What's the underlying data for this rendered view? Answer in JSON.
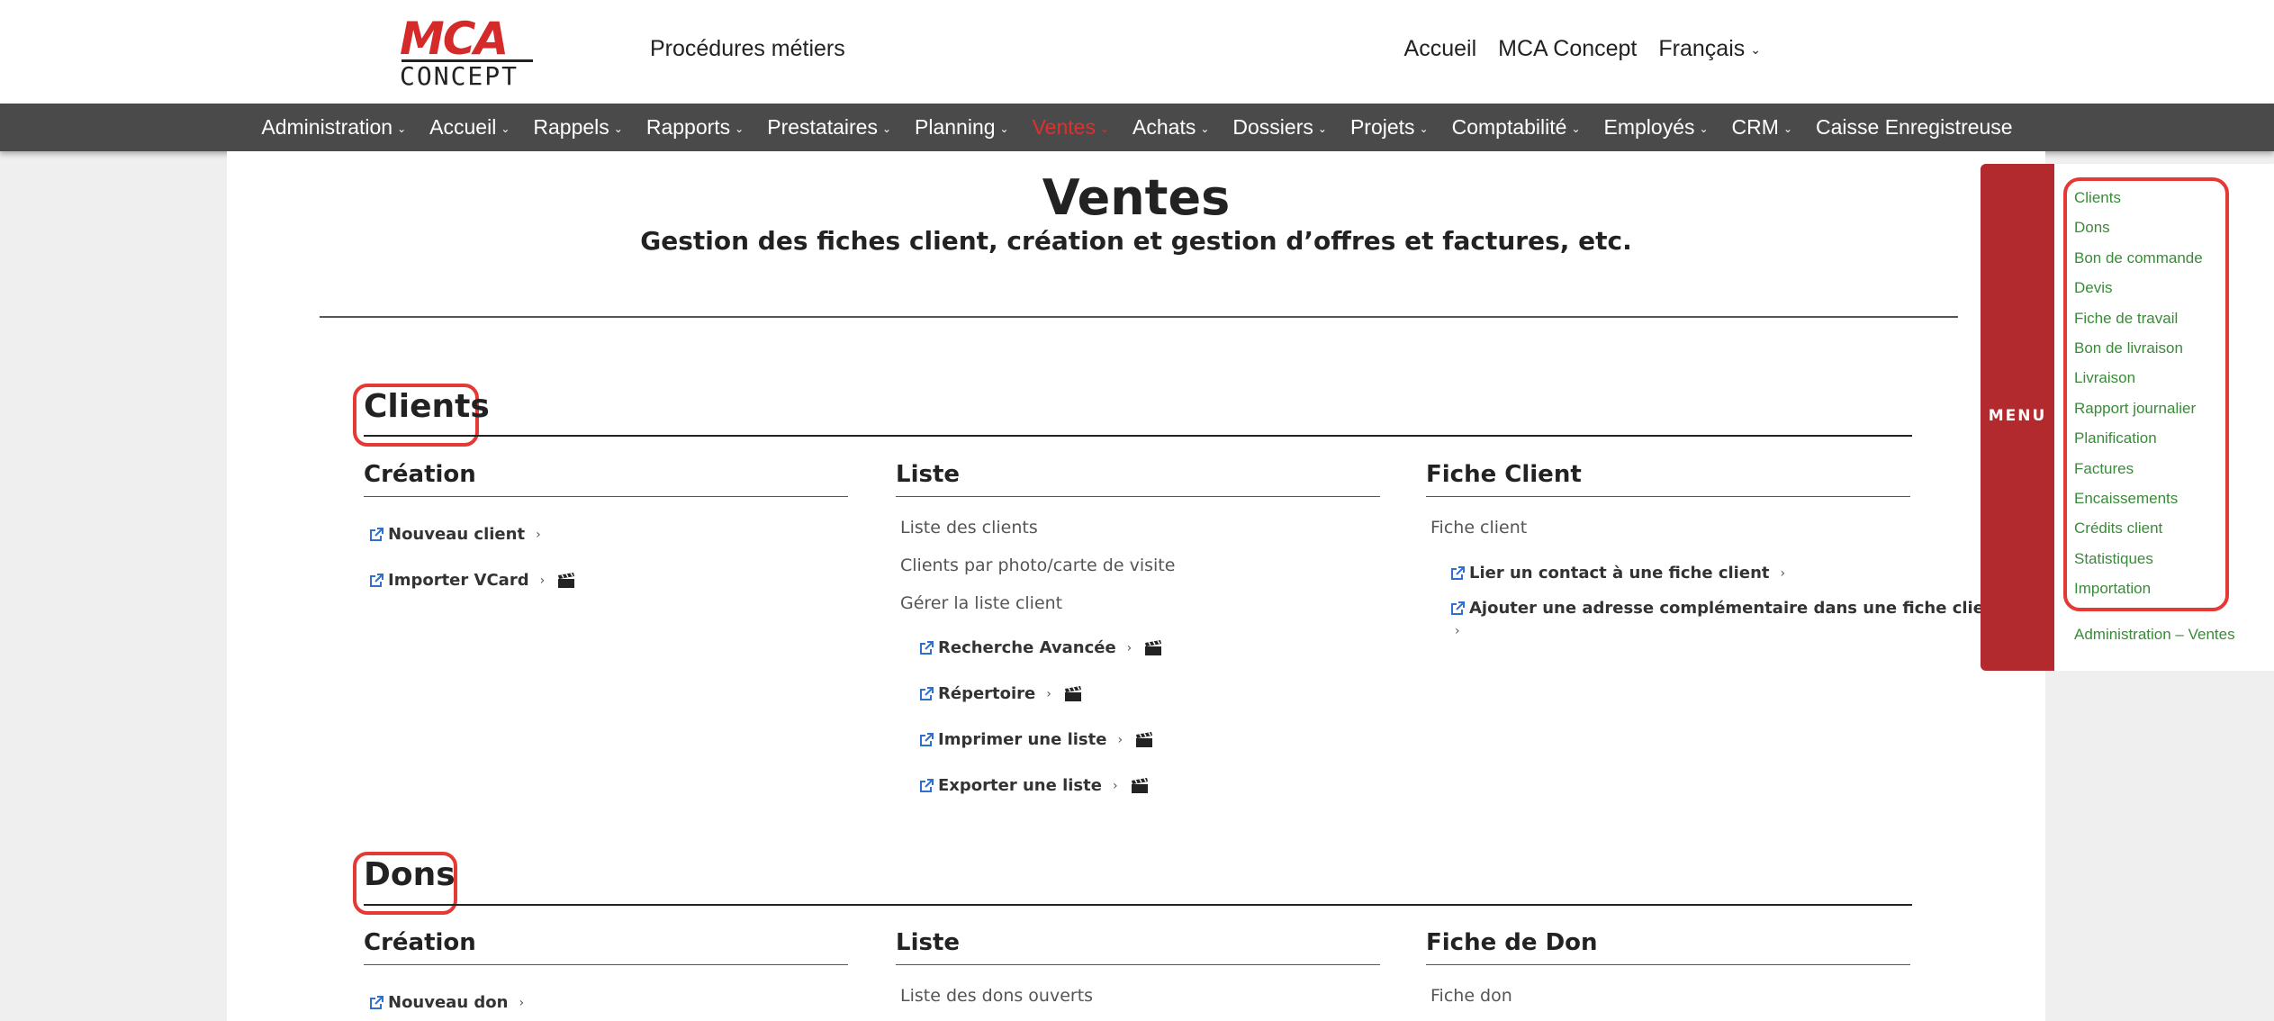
{
  "header": {
    "logo_top": "MCA",
    "logo_bottom": "CONCEPT",
    "title": "Procédures métiers",
    "links": [
      "Accueil",
      "MCA Concept",
      "Français"
    ]
  },
  "nav": [
    {
      "label": "Administration",
      "chevron": true
    },
    {
      "label": "Accueil",
      "chevron": true
    },
    {
      "label": "Rappels",
      "chevron": true
    },
    {
      "label": "Rapports",
      "chevron": true
    },
    {
      "label": "Prestataires",
      "chevron": true
    },
    {
      "label": "Planning",
      "chevron": true
    },
    {
      "label": "Ventes",
      "chevron": true,
      "active": true
    },
    {
      "label": "Achats",
      "chevron": true
    },
    {
      "label": "Dossiers",
      "chevron": true
    },
    {
      "label": "Projets",
      "chevron": true
    },
    {
      "label": "Comptabilité",
      "chevron": true
    },
    {
      "label": "Employés",
      "chevron": true
    },
    {
      "label": "CRM",
      "chevron": true
    },
    {
      "label": "Caisse Enregistreuse",
      "chevron": false
    }
  ],
  "page": {
    "title": "Ventes",
    "subtitle": "Gestion des fiches client, création et gestion d’offres et factures, etc."
  },
  "clients": {
    "title": "Clients",
    "creation": {
      "title": "Création",
      "links": [
        "Nouveau client",
        "Importer VCard"
      ]
    },
    "liste": {
      "title": "Liste",
      "items": [
        "Liste des clients",
        "Clients par photo/carte de visite",
        "Gérer la liste client"
      ],
      "links": [
        "Recherche Avancée",
        "Répertoire",
        "Imprimer une liste",
        "Exporter une liste"
      ]
    },
    "fiche": {
      "title": "Fiche Client",
      "items": [
        "Fiche client"
      ],
      "links": [
        "Lier un contact à une fiche client",
        "Ajouter une adresse complémentaire dans une fiche client"
      ]
    }
  },
  "dons": {
    "title": "Dons",
    "creation": {
      "title": "Création",
      "links": [
        "Nouveau don"
      ]
    },
    "liste": {
      "title": "Liste",
      "items": [
        "Liste des dons ouverts"
      ]
    },
    "fiche": {
      "title": "Fiche de Don",
      "items": [
        "Fiche don"
      ]
    }
  },
  "side_menu": {
    "tab_label": "MENU",
    "links": [
      "Clients",
      "Dons",
      "Bon de commande",
      "Devis",
      "Fiche de travail",
      "Bon de livraison",
      "Livraison",
      "Rapport journalier",
      "Planification",
      "Factures",
      "Encaissements",
      "Crédits client",
      "Statistiques",
      "Importation"
    ],
    "footer_link": "Administration – Ventes"
  },
  "colors": {
    "accent_red": "#d42a2a",
    "nav_bg": "#4a4a4a",
    "side_tab": "#b22a2e",
    "side_link": "#3a8a3a",
    "highlight": "#e53935",
    "icon_blue": "#2f6fd0"
  }
}
